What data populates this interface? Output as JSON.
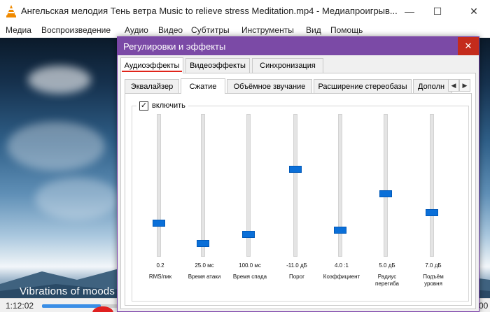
{
  "window": {
    "title": "Ангельская мелодия Тень ветра Music to relieve stress Meditation.mp4 - Медиапроигрыв...",
    "minimize": "—",
    "maximize": "☐",
    "close": "✕"
  },
  "menu": [
    "Медиа",
    "Воспроизведение",
    "Аудио",
    "Видео",
    "Субтитры",
    "Инструменты",
    "Вид",
    "Помощь"
  ],
  "video": {
    "caption": "Vibrations of moods",
    "time_elapsed": "1:12:02",
    "time_total": "00",
    "progress": 0.14
  },
  "dialog": {
    "title": "Регулировки и эффекты",
    "close": "✕",
    "tabs": [
      "Аудиоэффекты",
      "Видеоэффекты",
      "Синхронизация"
    ],
    "active_tab": "Аудиоэффекты",
    "subtabs": [
      "Эквалайзер",
      "Сжатие",
      "Объёмное звучание",
      "Расширение стереобазы",
      "Дополн"
    ],
    "active_subtab": "Сжатие",
    "arrow_left": "◀",
    "arrow_right": "▶",
    "enable": {
      "label": "включить",
      "checked": true,
      "mark": "✓"
    },
    "sliders": [
      {
        "value": "0.2",
        "label": "RMS/пик",
        "level": 0.22
      },
      {
        "value": "25.0 мс",
        "label": "Время атаки",
        "level": 0.07
      },
      {
        "value": "100.0 мс",
        "label": "Время спада",
        "level": 0.14
      },
      {
        "value": "-11.0 дБ",
        "label": "Порог",
        "level": 0.62
      },
      {
        "value": "4.0 :1",
        "label": "Коэффициент",
        "level": 0.17
      },
      {
        "value": "5.0 дБ",
        "label": "Радиус\nперегиба",
        "level": 0.44
      },
      {
        "value": "7.0 дБ",
        "label": "Подъём\nуровня",
        "level": 0.3
      }
    ]
  },
  "colors": {
    "dialog_title_bg": "#7b4aa6",
    "close_bg": "#c42b1c",
    "thumb": "#0a6fd8",
    "underline": "#e0241a",
    "seek": "#3a8ee6"
  }
}
